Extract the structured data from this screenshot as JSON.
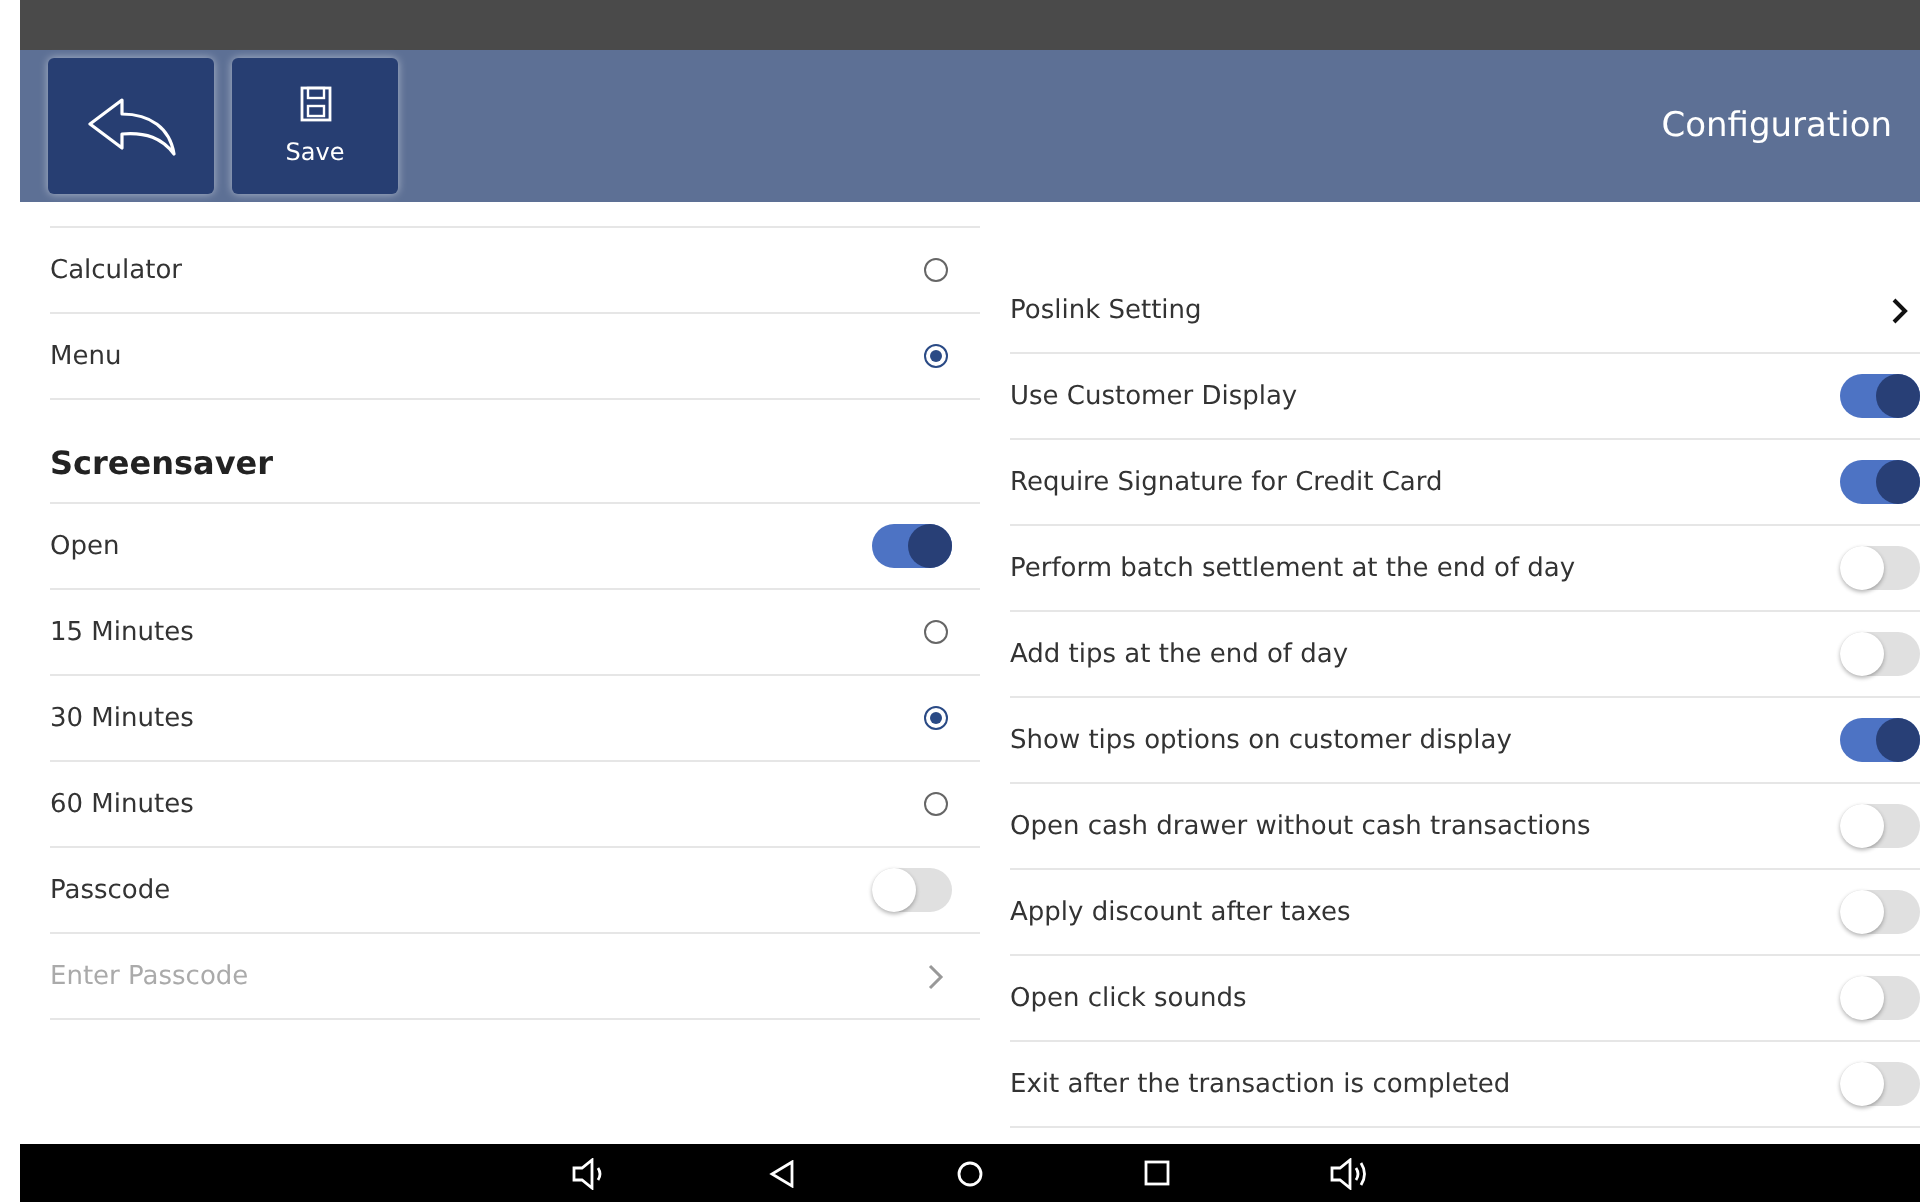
{
  "header": {
    "save_button": {
      "label": "Save"
    },
    "title": "Configuration"
  },
  "left": {
    "groups": [
      {
        "items": [
          {
            "kind": "radio",
            "label": "Calculator",
            "selected": false
          },
          {
            "kind": "radio",
            "label": "Menu",
            "selected": true
          }
        ]
      },
      {
        "heading": "Screensaver",
        "items": [
          {
            "kind": "toggle",
            "label": "Open",
            "on": true
          },
          {
            "kind": "radio",
            "label": "15 Minutes",
            "selected": false
          },
          {
            "kind": "radio",
            "label": "30 Minutes",
            "selected": true
          },
          {
            "kind": "radio",
            "label": "60 Minutes",
            "selected": false
          },
          {
            "kind": "toggle",
            "label": "Passcode",
            "on": false
          },
          {
            "kind": "link",
            "label": "Enter Passcode",
            "disabled": true
          }
        ]
      }
    ]
  },
  "right": {
    "items": [
      {
        "kind": "link",
        "label": "Poslink Setting",
        "disabled": false
      },
      {
        "kind": "toggle",
        "label": "Use Customer Display",
        "on": true
      },
      {
        "kind": "toggle",
        "label": "Require Signature for Credit Card",
        "on": true
      },
      {
        "kind": "toggle",
        "label": "Perform batch settlement at the end of day",
        "on": false
      },
      {
        "kind": "toggle",
        "label": "Add tips at the end of day",
        "on": false
      },
      {
        "kind": "toggle",
        "label": "Show tips options on customer display",
        "on": true
      },
      {
        "kind": "toggle",
        "label": "Open cash drawer without cash transactions",
        "on": false
      },
      {
        "kind": "toggle",
        "label": "Apply discount after taxes",
        "on": false
      },
      {
        "kind": "toggle",
        "label": "Open click sounds",
        "on": false
      },
      {
        "kind": "toggle",
        "label": "Exit after the transaction is completed",
        "on": false
      }
    ]
  }
}
